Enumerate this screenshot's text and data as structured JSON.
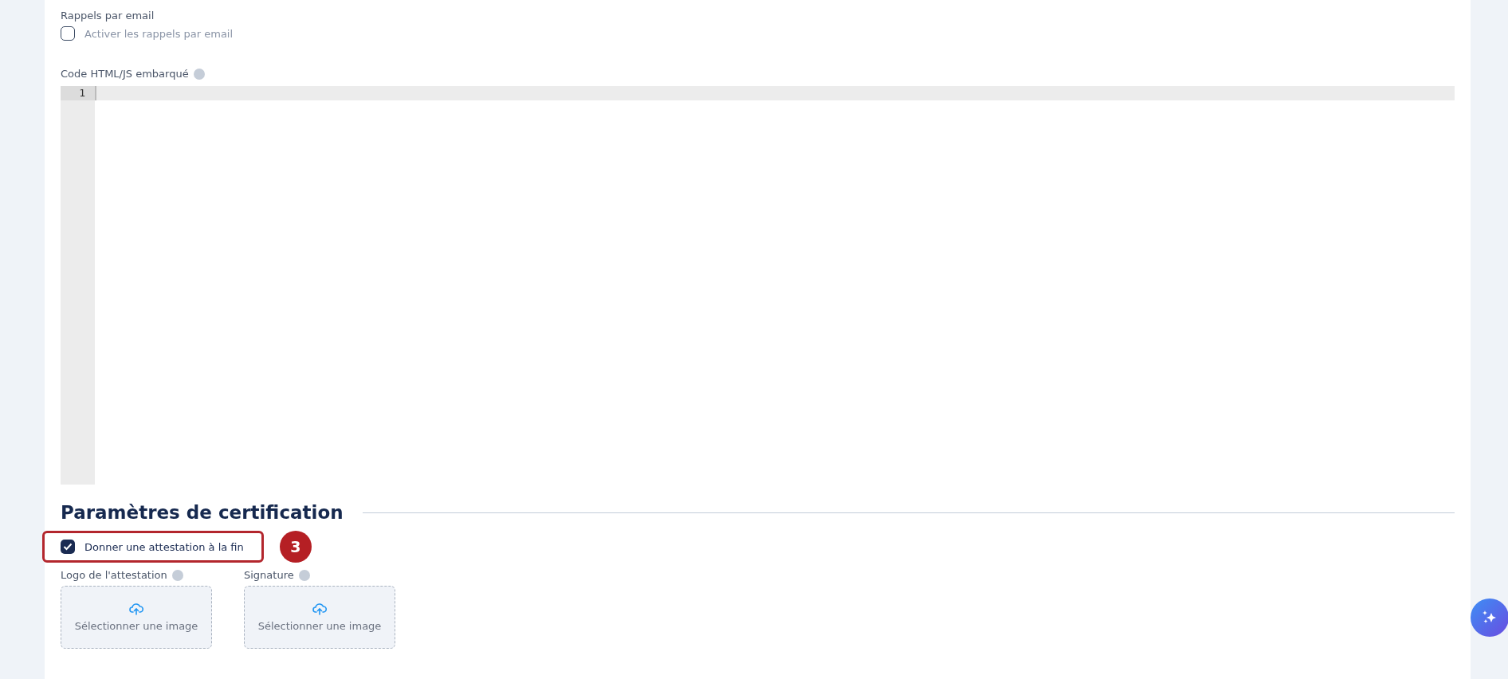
{
  "reminders": {
    "label": "Rappels par email",
    "checkbox": {
      "label": "Activer les rappels par email",
      "checked": false
    }
  },
  "code_editor": {
    "label": "Code HTML/JS embarqué",
    "lines": [
      "1"
    ]
  },
  "certification": {
    "title": "Paramètres de certification",
    "checkbox": {
      "label": "Donner une attestation à la fin",
      "checked": true,
      "highlighted": true
    },
    "step_badge": "3",
    "uploads": [
      {
        "label": "Logo de l'attestation",
        "button": "Sélectionner une image"
      },
      {
        "label": "Signature",
        "button": "Sélectionner une image"
      }
    ]
  }
}
